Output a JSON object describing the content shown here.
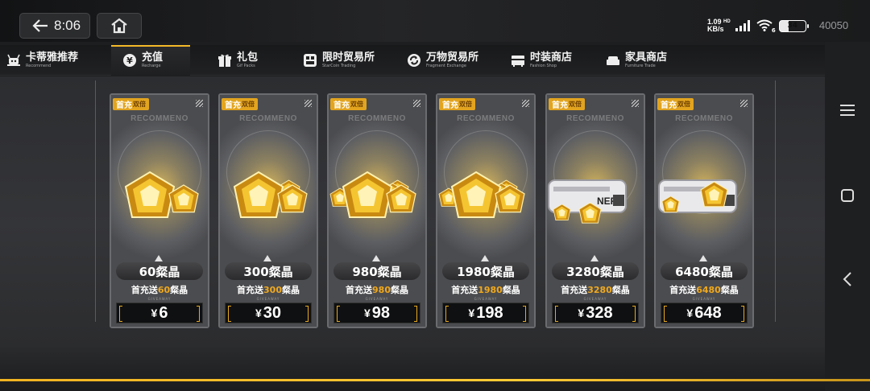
{
  "status_bar": {
    "time": "8:06",
    "net_speed": "1.09",
    "net_unit": "KB/s",
    "hd_label": "HD",
    "wifi_label": "6",
    "battery": "34",
    "currency_amount": "40050"
  },
  "tabs": [
    {
      "label": "卡蒂雅推荐",
      "sub": "Recommend",
      "icon": "robot-icon",
      "active": false
    },
    {
      "label": "充值",
      "sub": "Recharge",
      "icon": "yen-coin-icon",
      "active": true
    },
    {
      "label": "礼包",
      "sub": "Gif Packs",
      "icon": "gift-icon",
      "active": false
    },
    {
      "label": "限时贸易所",
      "sub": "StarCoin Trading",
      "icon": "timer-exchange-icon",
      "active": false
    },
    {
      "label": "万物贸易所",
      "sub": "Fragment Exchange",
      "icon": "cycle-exchange-icon",
      "active": false
    },
    {
      "label": "时装商店",
      "sub": "Fashion Shop",
      "icon": "wardrobe-icon",
      "active": false
    },
    {
      "label": "家具商店",
      "sub": "Furniture Trade",
      "icon": "sofa-icon",
      "active": false
    }
  ],
  "packages": [
    {
      "badge": "首充",
      "badge_sub": "双倍",
      "rec": "RECOMMENO",
      "amount": "60粲晶",
      "bonus_pre": "首充送",
      "bonus_num": "60",
      "bonus_post": "粲晶",
      "currency": "¥",
      "price": "6",
      "give": "GIVEAWAY"
    },
    {
      "badge": "首充",
      "badge_sub": "双倍",
      "rec": "RECOMMENO",
      "amount": "300粲晶",
      "bonus_pre": "首充送",
      "bonus_num": "300",
      "bonus_post": "粲晶",
      "currency": "¥",
      "price": "30",
      "give": "GIVEAWAY"
    },
    {
      "badge": "首充",
      "badge_sub": "双倍",
      "rec": "RECOMMENO",
      "amount": "980粲晶",
      "bonus_pre": "首充送",
      "bonus_num": "980",
      "bonus_post": "粲晶",
      "currency": "¥",
      "price": "98",
      "give": "GIVEAWAY"
    },
    {
      "badge": "首充",
      "badge_sub": "双倍",
      "rec": "RECOMMENO",
      "amount": "1980粲晶",
      "bonus_pre": "首充送",
      "bonus_num": "1980",
      "bonus_post": "粲晶",
      "currency": "¥",
      "price": "198",
      "give": "GIVEAWAY"
    },
    {
      "badge": "首充",
      "badge_sub": "双倍",
      "rec": "RECOMMENO",
      "amount": "3280粲晶",
      "bonus_pre": "首充送",
      "bonus_num": "3280",
      "bonus_post": "粲晶",
      "currency": "¥",
      "price": "328",
      "give": "GIVEAWAY"
    },
    {
      "badge": "首充",
      "badge_sub": "双倍",
      "rec": "RECOMMENO",
      "amount": "6480粲晶",
      "bonus_pre": "首充送",
      "bonus_num": "6480",
      "bonus_post": "粲晶",
      "currency": "¥",
      "price": "648",
      "give": "GIVEAWAY"
    }
  ],
  "nav_buttons": [
    "menu-icon",
    "home-square-icon",
    "back-chevron-icon"
  ],
  "colors": {
    "accent": "#f4b928",
    "badge": "#e2a41f",
    "bonus_highlight": "#f0a91d"
  }
}
